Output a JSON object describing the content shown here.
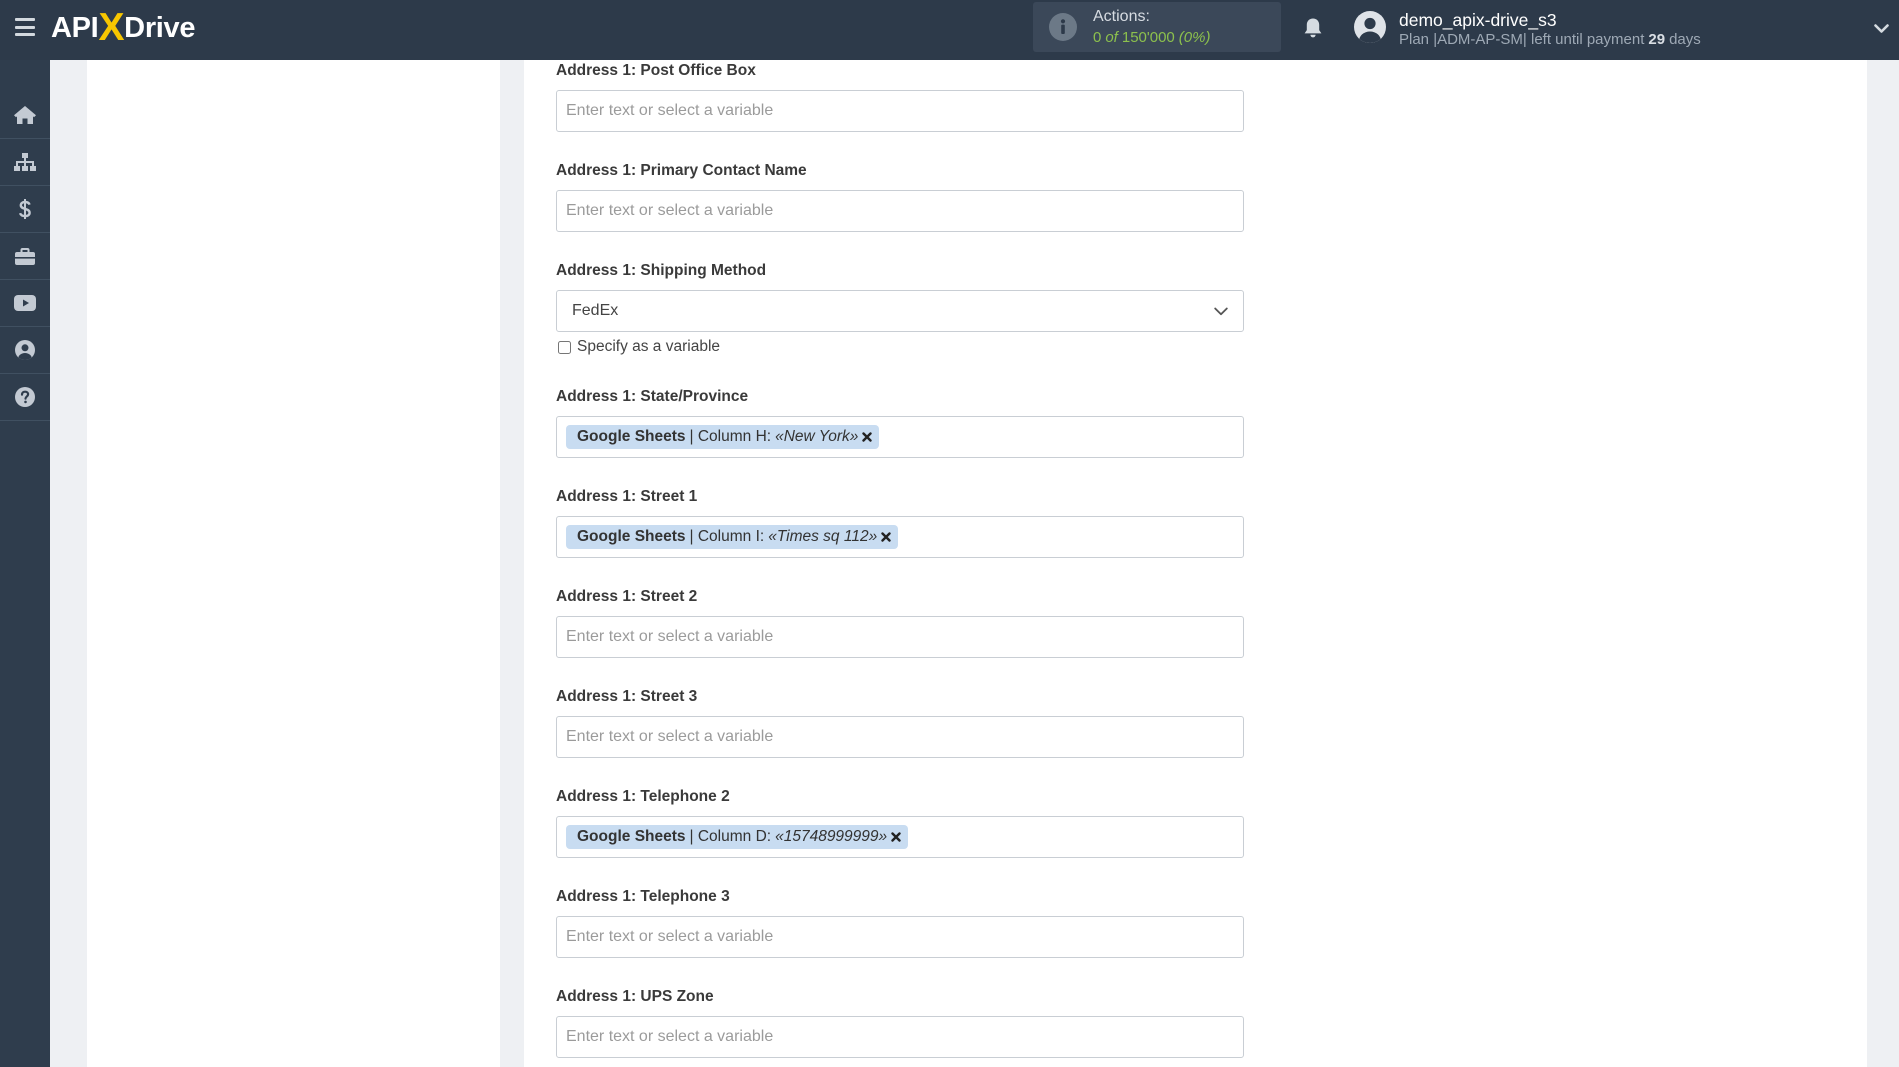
{
  "theme": {
    "topbar_bg": "#2d3a4a",
    "sidebar_bg": "#2f3d4d",
    "logo_accent": "#f7c600",
    "tag_bg": "#c8dcf1",
    "counter_color": "#8cc04d"
  },
  "header": {
    "menu_icon": "hamburger-menu-icon",
    "logo": {
      "api": "API",
      "x": "X",
      "drive": "Drive"
    },
    "actions": {
      "icon": "info-circle-icon",
      "label": "Actions:",
      "used": "0",
      "of": "of",
      "limit": "150'000",
      "percent": "(0%)"
    },
    "notifications_icon": "bell-icon",
    "user": {
      "avatar_icon": "user-avatar-icon",
      "name": "demo_apix-drive_s3",
      "plan_text": "Plan |ADM-AP-SM| left until payment",
      "days_left": "29",
      "days_label": "days"
    },
    "account_menu_icon": "chevron-down-icon"
  },
  "sidebar": {
    "items": [
      {
        "icon": "home-icon"
      },
      {
        "icon": "sitemap-icon"
      },
      {
        "icon": "dollar-icon"
      },
      {
        "icon": "briefcase-icon"
      },
      {
        "icon": "youtube-icon"
      },
      {
        "icon": "user-circle-icon"
      },
      {
        "icon": "question-circle-icon"
      }
    ]
  },
  "form": {
    "fields": [
      {
        "label": "Address 1: Post Office Box",
        "placeholder": "Enter text or select a variable"
      },
      {
        "label": "Address 1: Primary Contact Name",
        "placeholder": "Enter text or select a variable"
      },
      {
        "label": "Address 1: Shipping Method",
        "value": "FedEx",
        "checkbox_label": "Specify as a variable",
        "checkbox_checked": false
      },
      {
        "label": "Address 1: State/Province",
        "tag": {
          "source": "Google Sheets",
          "column": "| Column H:",
          "value": "«New York»"
        }
      },
      {
        "label": "Address 1: Street 1",
        "tag": {
          "source": "Google Sheets",
          "column": "| Column I:",
          "value": "«Times sq 112»"
        }
      },
      {
        "label": "Address 1: Street 2",
        "placeholder": "Enter text or select a variable"
      },
      {
        "label": "Address 1: Street 3",
        "placeholder": "Enter text or select a variable"
      },
      {
        "label": "Address 1: Telephone 2",
        "tag": {
          "source": "Google Sheets",
          "column": "| Column D:",
          "value": "«15748999999»"
        }
      },
      {
        "label": "Address 1: Telephone 3",
        "placeholder": "Enter text or select a variable"
      },
      {
        "label": "Address 1: UPS Zone",
        "placeholder": "Enter text or select a variable"
      }
    ]
  }
}
